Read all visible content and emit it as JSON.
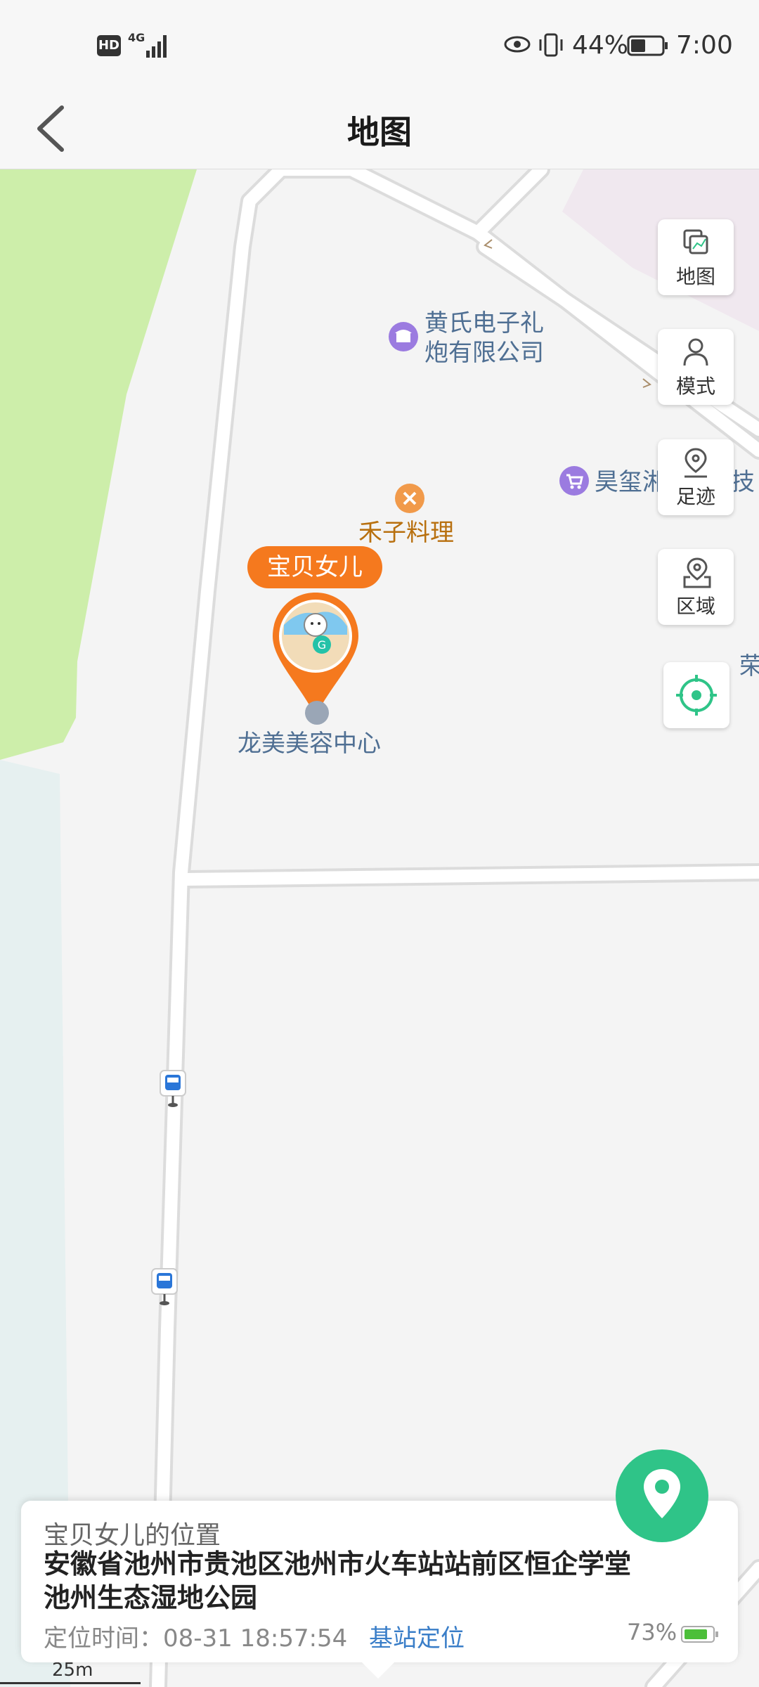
{
  "status_bar": {
    "hd": "HD",
    "network": "4G",
    "battery": "44%",
    "time": "7:00"
  },
  "header": {
    "title": "地图"
  },
  "map": {
    "pois": {
      "company1_line1": "黄氏电子礼",
      "company1_line2": "炮有限公司",
      "restaurant": "禾子料理",
      "shop": "昊玺湘",
      "shop_suffix": "技",
      "edge_label": "荣",
      "beauty": "龙美美容中心"
    },
    "marker_name": "宝贝女儿",
    "scale": "25m"
  },
  "side_buttons": [
    {
      "label": "地图",
      "icon": "layers-icon"
    },
    {
      "label": "模式",
      "icon": "person-icon"
    },
    {
      "label": "足迹",
      "icon": "footprint-pin-icon"
    },
    {
      "label": "区域",
      "icon": "area-pin-icon"
    }
  ],
  "card": {
    "title": "宝贝女儿的位置",
    "address_line1": "安徽省池州市贵池区池州市火车站站前区恒企学堂",
    "address_line2": "池州生态湿地公园",
    "time_label": "定位时间：08-31 18:57:54",
    "location_type": "基站定位",
    "device_battery": "73%"
  },
  "colors": {
    "accent_orange": "#f5791e",
    "accent_green": "#2fc488",
    "link_blue": "#3a7ec8",
    "park_green": "#cdeeaa",
    "water": "#e6f0f0"
  }
}
